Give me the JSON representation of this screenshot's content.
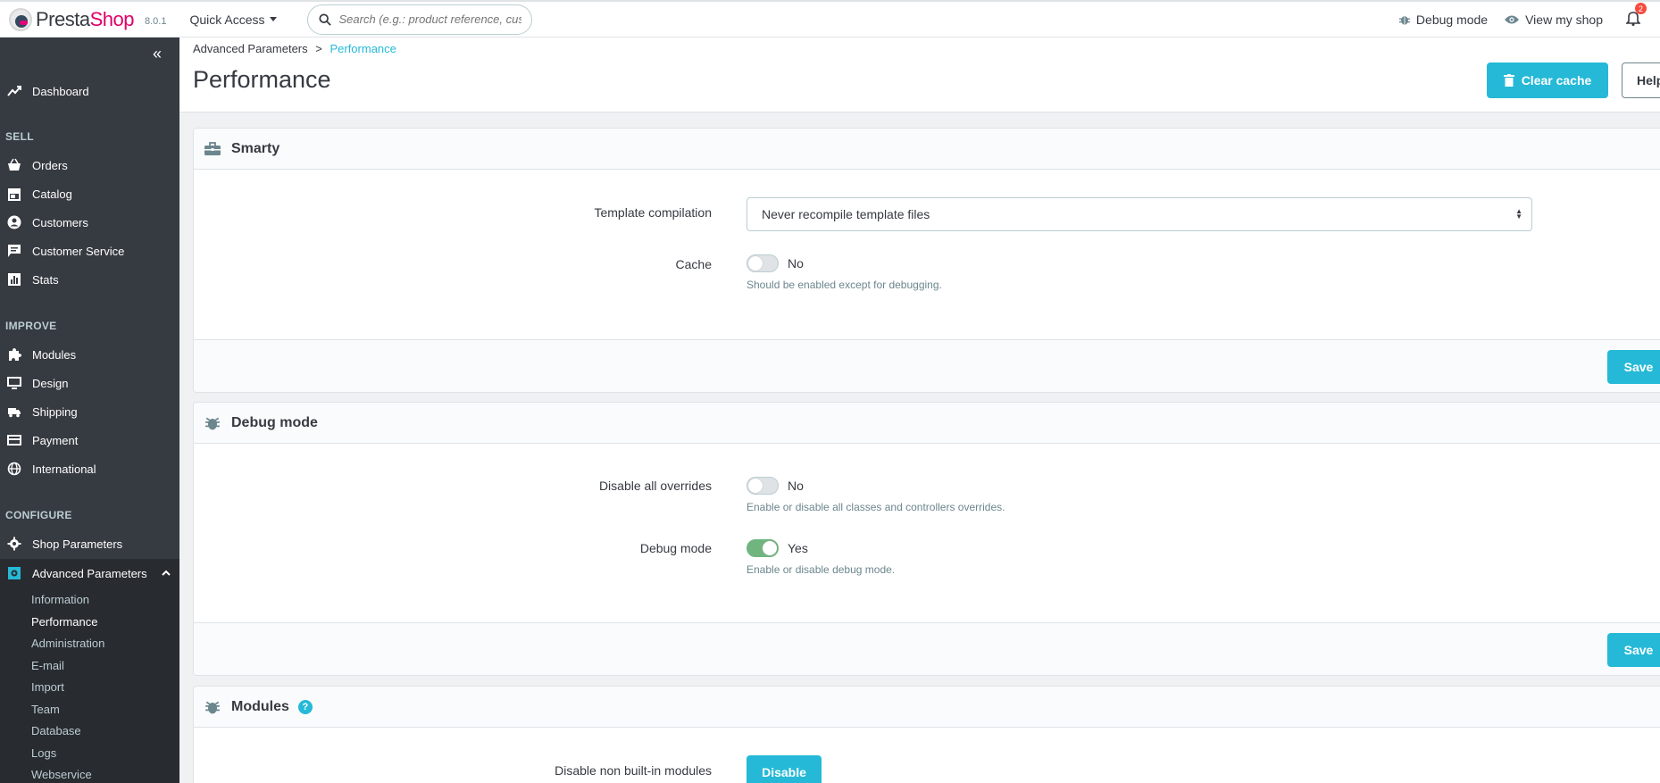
{
  "brand": {
    "name_part1": "Presta",
    "name_part2": "Shop",
    "version": "8.0.1"
  },
  "topbar": {
    "quick_access": "Quick Access",
    "search_placeholder": "Search (e.g.: product reference, custon",
    "debug_mode": "Debug mode",
    "view_shop": "View my shop",
    "notifications_count": "2"
  },
  "sidebar": {
    "dashboard": "Dashboard",
    "sections": {
      "sell": "SELL",
      "improve": "IMPROVE",
      "configure": "CONFIGURE"
    },
    "sell_items": [
      "Orders",
      "Catalog",
      "Customers",
      "Customer Service",
      "Stats"
    ],
    "improve_items": [
      "Modules",
      "Design",
      "Shipping",
      "Payment",
      "International"
    ],
    "configure_items": [
      "Shop Parameters",
      "Advanced Parameters"
    ],
    "sub_items": [
      "Information",
      "Performance",
      "Administration",
      "E-mail",
      "Import",
      "Team",
      "Database",
      "Logs",
      "Webservice"
    ]
  },
  "header": {
    "breadcrumb_parent": "Advanced Parameters",
    "breadcrumb_sep": ">",
    "breadcrumb_current": "Performance",
    "title": "Performance",
    "clear_cache": "Clear cache",
    "help": "Help"
  },
  "smarty": {
    "title": "Smarty",
    "template_label": "Template compilation",
    "template_value": "Never recompile template files",
    "cache_label": "Cache",
    "cache_value": "No",
    "cache_help": "Should be enabled except for debugging.",
    "save": "Save"
  },
  "debug": {
    "title": "Debug mode",
    "overrides_label": "Disable all overrides",
    "overrides_value": "No",
    "overrides_help": "Enable or disable all classes and controllers overrides.",
    "debug_label": "Debug mode",
    "debug_value": "Yes",
    "debug_help": "Enable or disable debug mode.",
    "save": "Save"
  },
  "modules": {
    "title": "Modules",
    "help_badge": "?",
    "nonbuiltin_label": "Disable non built-in modules",
    "disable_button": "Disable"
  },
  "colors": {
    "accent": "#25b9d7",
    "sidebar": "#363a41",
    "switch_on": "#70b580",
    "brand_pink": "#df0067"
  }
}
